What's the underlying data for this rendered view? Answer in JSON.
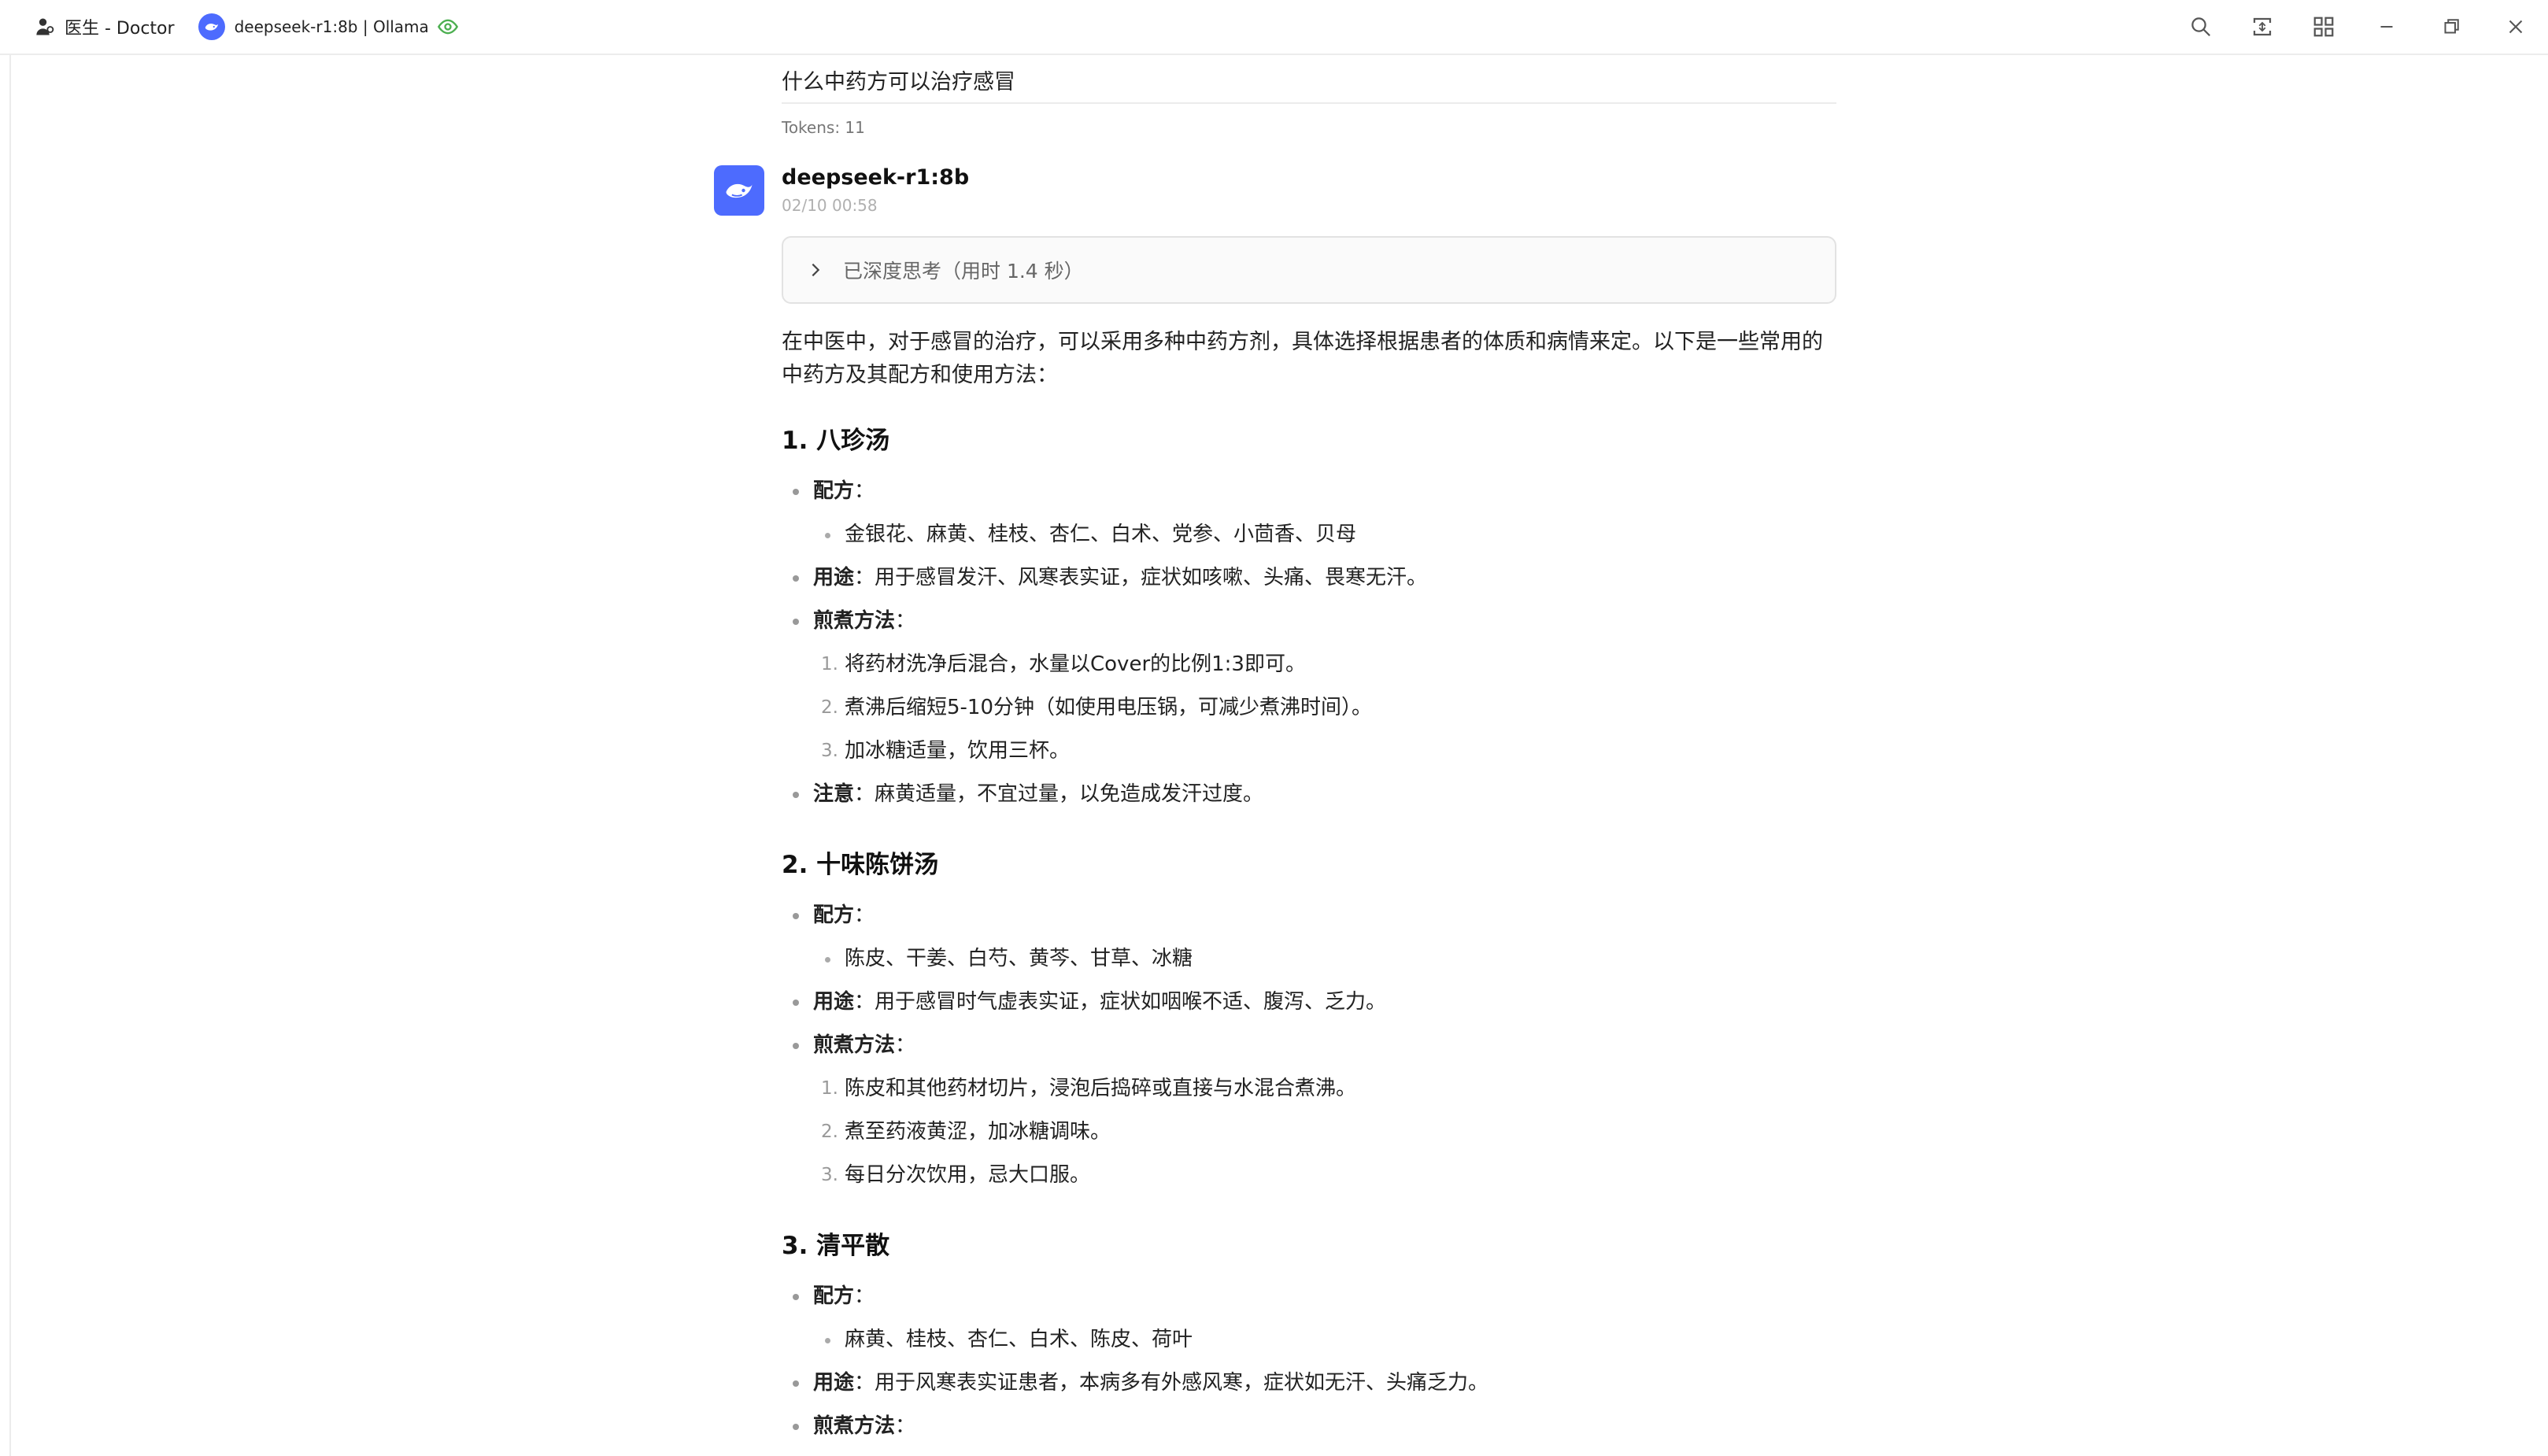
{
  "titlebar": {
    "assistant_name": "医生 - Doctor",
    "model_label": "deepseek-r1:8b | Ollama",
    "icons": [
      "user-doctor-icon",
      "deepseek-whale-icon",
      "eye-icon",
      "search-icon",
      "expand-icon",
      "grid-icon",
      "minimize-icon",
      "restore-icon",
      "close-icon"
    ]
  },
  "conversation": {
    "user_question": "什么中药方可以治疗感冒",
    "tokens": "Tokens: 11",
    "model_name": "deepseek-r1:8b",
    "timestamp": "02/10 00:58",
    "thinking_label": "已深度思考（用时 1.4 秒）",
    "intro": "在中医中，对于感冒的治疗，可以采用多种中药方剂，具体选择根据患者的体质和病情来定。以下是一些常用的中药方及其配方和使用方法：",
    "colors": {
      "accent": "#4d6bfe",
      "eye": "#4caf50"
    }
  },
  "sections": [
    {
      "heading": "1. 八珍汤",
      "formula_label": "配方",
      "formula_colon": "：",
      "formula": "金银花、麻黄、桂枝、杏仁、白术、党参、小茴香、贝母",
      "usage_label": "用途",
      "usage": "：用于感冒发汗、风寒表实证，症状如咳嗽、头痛、畏寒无汗。",
      "method_label": "煎煮方法",
      "method_colon": "：",
      "steps": [
        "将药材洗净后混合，水量以Cover的比例1:3即可。",
        "煮沸后缩短5-10分钟（如使用电压锅，可减少煮沸时间）。",
        "加冰糖适量，饮用三杯。"
      ],
      "note_label": "注意",
      "note": "：麻黄适量，不宜过量，以免造成发汗过度。"
    },
    {
      "heading": "2. 十味陈饼汤",
      "formula_label": "配方",
      "formula_colon": "：",
      "formula": "陈皮、干姜、白芍、黄芩、甘草、冰糖",
      "usage_label": "用途",
      "usage": "：用于感冒时气虚表实证，症状如咽喉不适、腹泻、乏力。",
      "method_label": "煎煮方法",
      "method_colon": "：",
      "steps": [
        "陈皮和其他药材切片，浸泡后捣碎或直接与水混合煮沸。",
        "煮至药液黄涩，加冰糖调味。",
        "每日分次饮用，忌大口服。"
      ]
    },
    {
      "heading": "3. 清平散",
      "formula_label": "配方",
      "formula_colon": "：",
      "formula": "麻黄、桂枝、杏仁、白术、陈皮、荷叶",
      "usage_label": "用途",
      "usage": "：用于风寒表实证患者，本病多有外感风寒，症状如无汗、头痛乏力。",
      "method_label": "煎煮方法",
      "method_colon": "："
    }
  ]
}
